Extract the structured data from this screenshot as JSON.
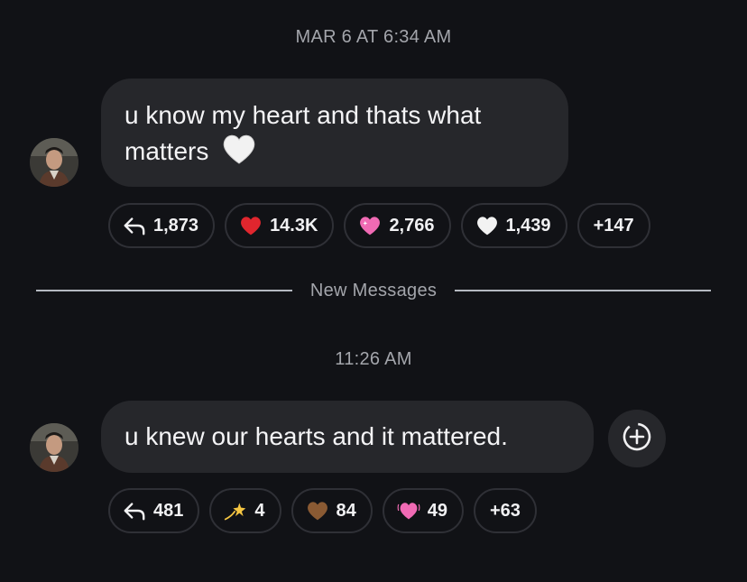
{
  "messages": [
    {
      "timestamp": "MAR 6 AT 6:34 AM",
      "text": "u know my heart and thats what matters 🤍",
      "text_line1": "u know my heart and thats what",
      "text_line2": "matters",
      "text_emoji": "white-heart",
      "reactions": [
        {
          "icon": "reply-arrow-icon",
          "count": "1,873"
        },
        {
          "icon": "red-heart-emoji",
          "count": "14.3K",
          "color": "#e0262e"
        },
        {
          "icon": "sparkling-heart-emoji",
          "count": "2,766",
          "color": "#f06ab4"
        },
        {
          "icon": "white-heart-emoji",
          "count": "1,439",
          "color": "#f2f2f2"
        },
        {
          "icon": "more",
          "count": "+147"
        }
      ]
    },
    {
      "timestamp": "11:26 AM",
      "text": "u knew our hearts and it mattered.",
      "reactions": [
        {
          "icon": "reply-arrow-icon",
          "count": "481"
        },
        {
          "icon": "dizzy-star-emoji",
          "count": "4",
          "color": "#f5c542"
        },
        {
          "icon": "brown-heart-emoji",
          "count": "84",
          "color": "#8a5a33"
        },
        {
          "icon": "beating-heart-emoji",
          "count": "49",
          "color": "#f06ab4"
        },
        {
          "icon": "more",
          "count": "+63"
        }
      ]
    }
  ],
  "divider": {
    "label": "New Messages"
  },
  "colors": {
    "background": "#111216",
    "bubble": "#26272b",
    "muted_text": "#a3a5ab",
    "pill_border": "#2f3036"
  }
}
